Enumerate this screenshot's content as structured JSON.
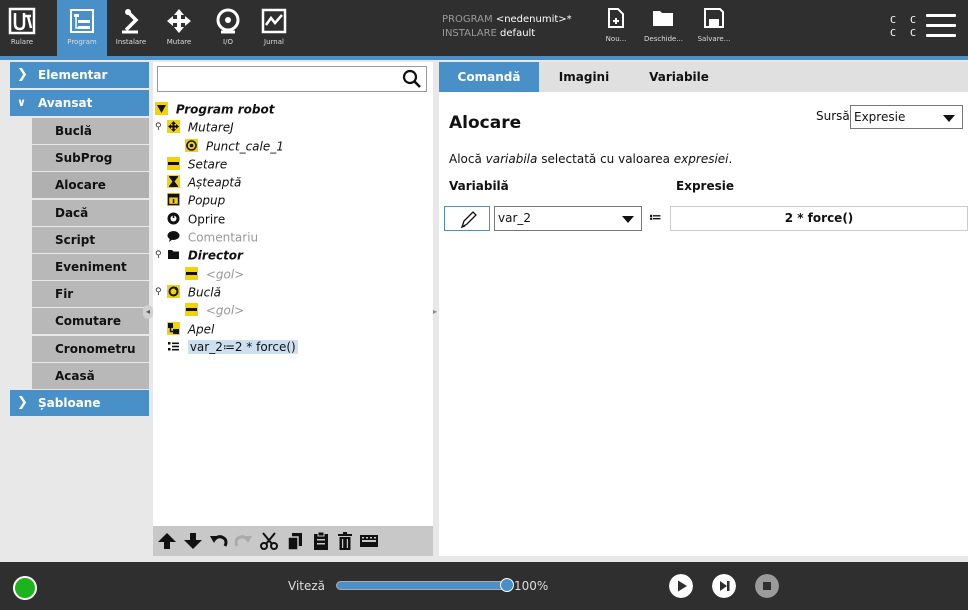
{
  "topbar": {
    "nav": [
      {
        "label": "Rulare",
        "icon": "ur-logo-icon"
      },
      {
        "label": "Program",
        "icon": "program-icon"
      },
      {
        "label": "Instalare",
        "icon": "robot-arm-icon"
      },
      {
        "label": "Mutare",
        "icon": "move-arrows-icon"
      },
      {
        "label": "I/O",
        "icon": "io-icon"
      },
      {
        "label": "Jurnal",
        "icon": "log-icon"
      }
    ],
    "program_label": "PROGRAM",
    "program_name": "<nedenumit>*",
    "install_label": "INSTALARE",
    "install_name": "default",
    "file_buttons": [
      {
        "label": "Nou...",
        "icon": "new-file-icon"
      },
      {
        "label": "Deschide...",
        "icon": "open-folder-icon"
      },
      {
        "label": "Salvare...",
        "icon": "save-icon"
      }
    ],
    "cc_row1": "C C",
    "cc_row2": "C C",
    "menu_icon": "hamburger-menu-icon"
  },
  "sidebar": {
    "categories": {
      "basic": "Elementar",
      "advanced": "Avansat",
      "templates": "Șabloane"
    },
    "advanced_items": [
      "Buclă",
      "SubProg",
      "Alocare",
      "Dacă",
      "Script",
      "Eveniment",
      "Fir",
      "Comutare",
      "Cronometru",
      "Acasă"
    ]
  },
  "tree": {
    "search_placeholder": "",
    "nodes": {
      "root": "Program robot",
      "movej": "MutareJ",
      "waypoint": "Punct_cale_1",
      "set": "Setare",
      "wait": "Așteaptă",
      "popup": "Popup",
      "halt": "Oprire",
      "comment": "Comentariu",
      "folder": "Director",
      "folder_empty": "<gol>",
      "loop": "Buclă",
      "loop_empty": "<gol>",
      "call": "Apel",
      "assignment": "var_2≔2 * force()"
    }
  },
  "right": {
    "tabs": [
      "Comandă",
      "Imagini",
      "Variabile"
    ],
    "title": "Alocare",
    "source_label": "Sursă",
    "source_value": "Expresie",
    "desc_part1": "Alocă ",
    "desc_var": "variabila",
    "desc_part2": " selectată cu valoarea ",
    "desc_expr": "expresiei",
    "desc_part3": ".",
    "var_label": "Variabilă",
    "expr_label": "Expresie",
    "var_value": "var_2",
    "assign_op": "≔",
    "expr_value": "2 * force()"
  },
  "bottombar": {
    "speed_label": "Viteză",
    "speed_value": "100%",
    "speed_fraction": 1.0,
    "colors": {
      "accent": "#4a90c8",
      "power_on": "#1db31d"
    }
  }
}
